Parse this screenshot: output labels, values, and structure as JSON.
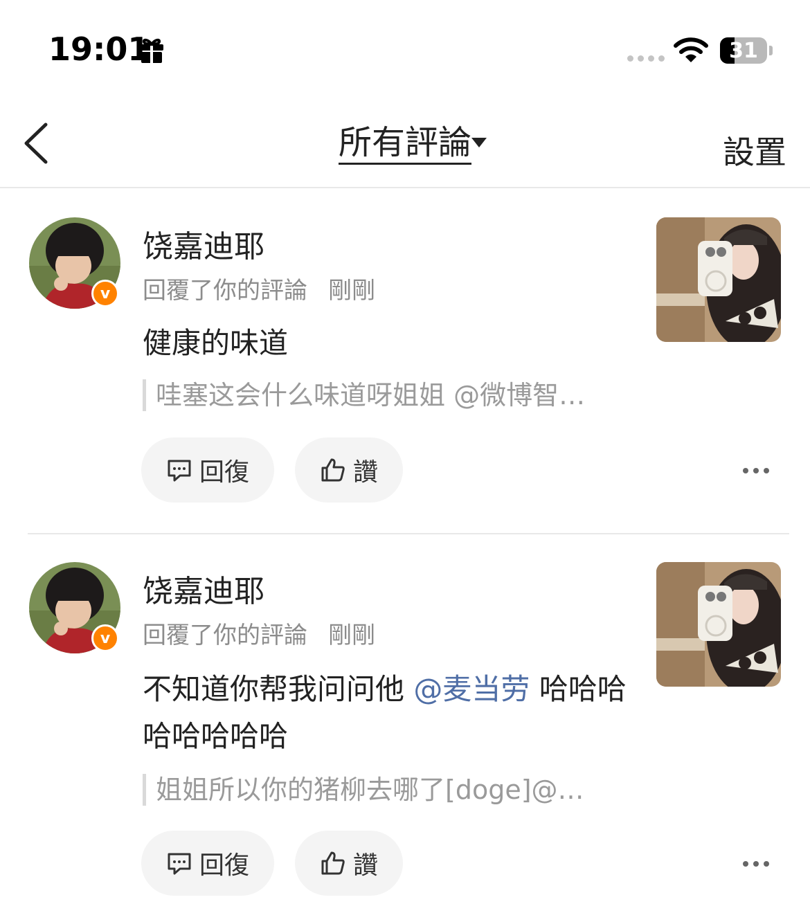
{
  "status_bar": {
    "time": "19:01",
    "battery_level": "31",
    "battery_percent": 31,
    "icons": [
      "gift-icon",
      "signal-dots",
      "wifi-icon",
      "battery-icon"
    ]
  },
  "nav": {
    "title": "所有評論",
    "settings_label": "設置",
    "icons": [
      "back-icon",
      "caret-down-icon"
    ]
  },
  "comments": [
    {
      "username": "饶嘉迪耶",
      "action": "回覆了你的評論",
      "time_ago": "剛剛",
      "content": "健康的味道",
      "quote": "哇塞这会什么味道呀姐姐 @微博智…",
      "reply_label": "回復",
      "like_label": "讚"
    },
    {
      "username": "饶嘉迪耶",
      "action": "回覆了你的評論",
      "time_ago": "剛剛",
      "content_before": "不知道你帮我问问他 ",
      "content_mention": "@麦当劳",
      "content_after": " 哈哈哈哈哈哈哈哈",
      "quote": "姐姐所以你的猪柳去哪了[doge]@…",
      "reply_label": "回復",
      "like_label": "讚"
    }
  ],
  "colors": {
    "verified_badge": "#ff8200",
    "mention": "#4f6ea6",
    "secondary_text": "#8c8c8c",
    "pill_bg": "#f4f4f4"
  }
}
